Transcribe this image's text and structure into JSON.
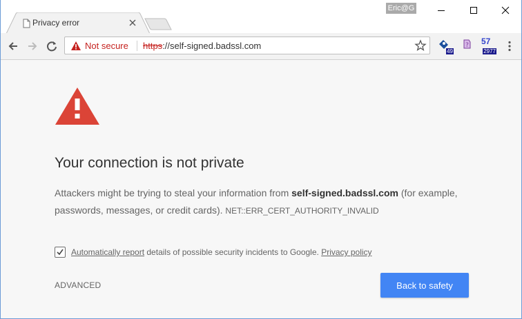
{
  "window": {
    "profile_name": "Eric@G",
    "accent_color": "#6b9bd6"
  },
  "tab": {
    "title": "Privacy error",
    "favicon": "page-icon",
    "close_icon": "close-icon"
  },
  "toolbar": {
    "back_icon": "arrow-left-icon",
    "forward_icon": "arrow-right-icon",
    "reload_icon": "reload-icon",
    "security_label": "Not secure",
    "url_scheme": "https",
    "url_rest": "://self-signed.badssl.com",
    "bookmark_icon": "star-icon",
    "extensions": [
      {
        "icon": "extension-icon",
        "badge": "49"
      },
      {
        "icon": "extension-icon",
        "badge": ""
      },
      {
        "icon": "extension-icon",
        "number": "57",
        "badge": "2977"
      }
    ],
    "menu_icon": "kebab-menu-icon"
  },
  "interstitial": {
    "heading": "Your connection is not private",
    "desc_prefix": "Attackers might be trying to steal your information from ",
    "desc_host": "self-signed.badssl.com",
    "desc_suffix": " (for example, passwords, messages, or credit cards). ",
    "error_code": "NET::ERR_CERT_AUTHORITY_INVALID",
    "report_link": "Automatically report",
    "report_text": " details of possible security incidents to Google. ",
    "privacy_link": "Privacy policy",
    "report_checked": true,
    "advanced_label": "ADVANCED",
    "back_button_label": "Back to safety",
    "warning_color": "#db4437",
    "button_color": "#4285f4"
  }
}
